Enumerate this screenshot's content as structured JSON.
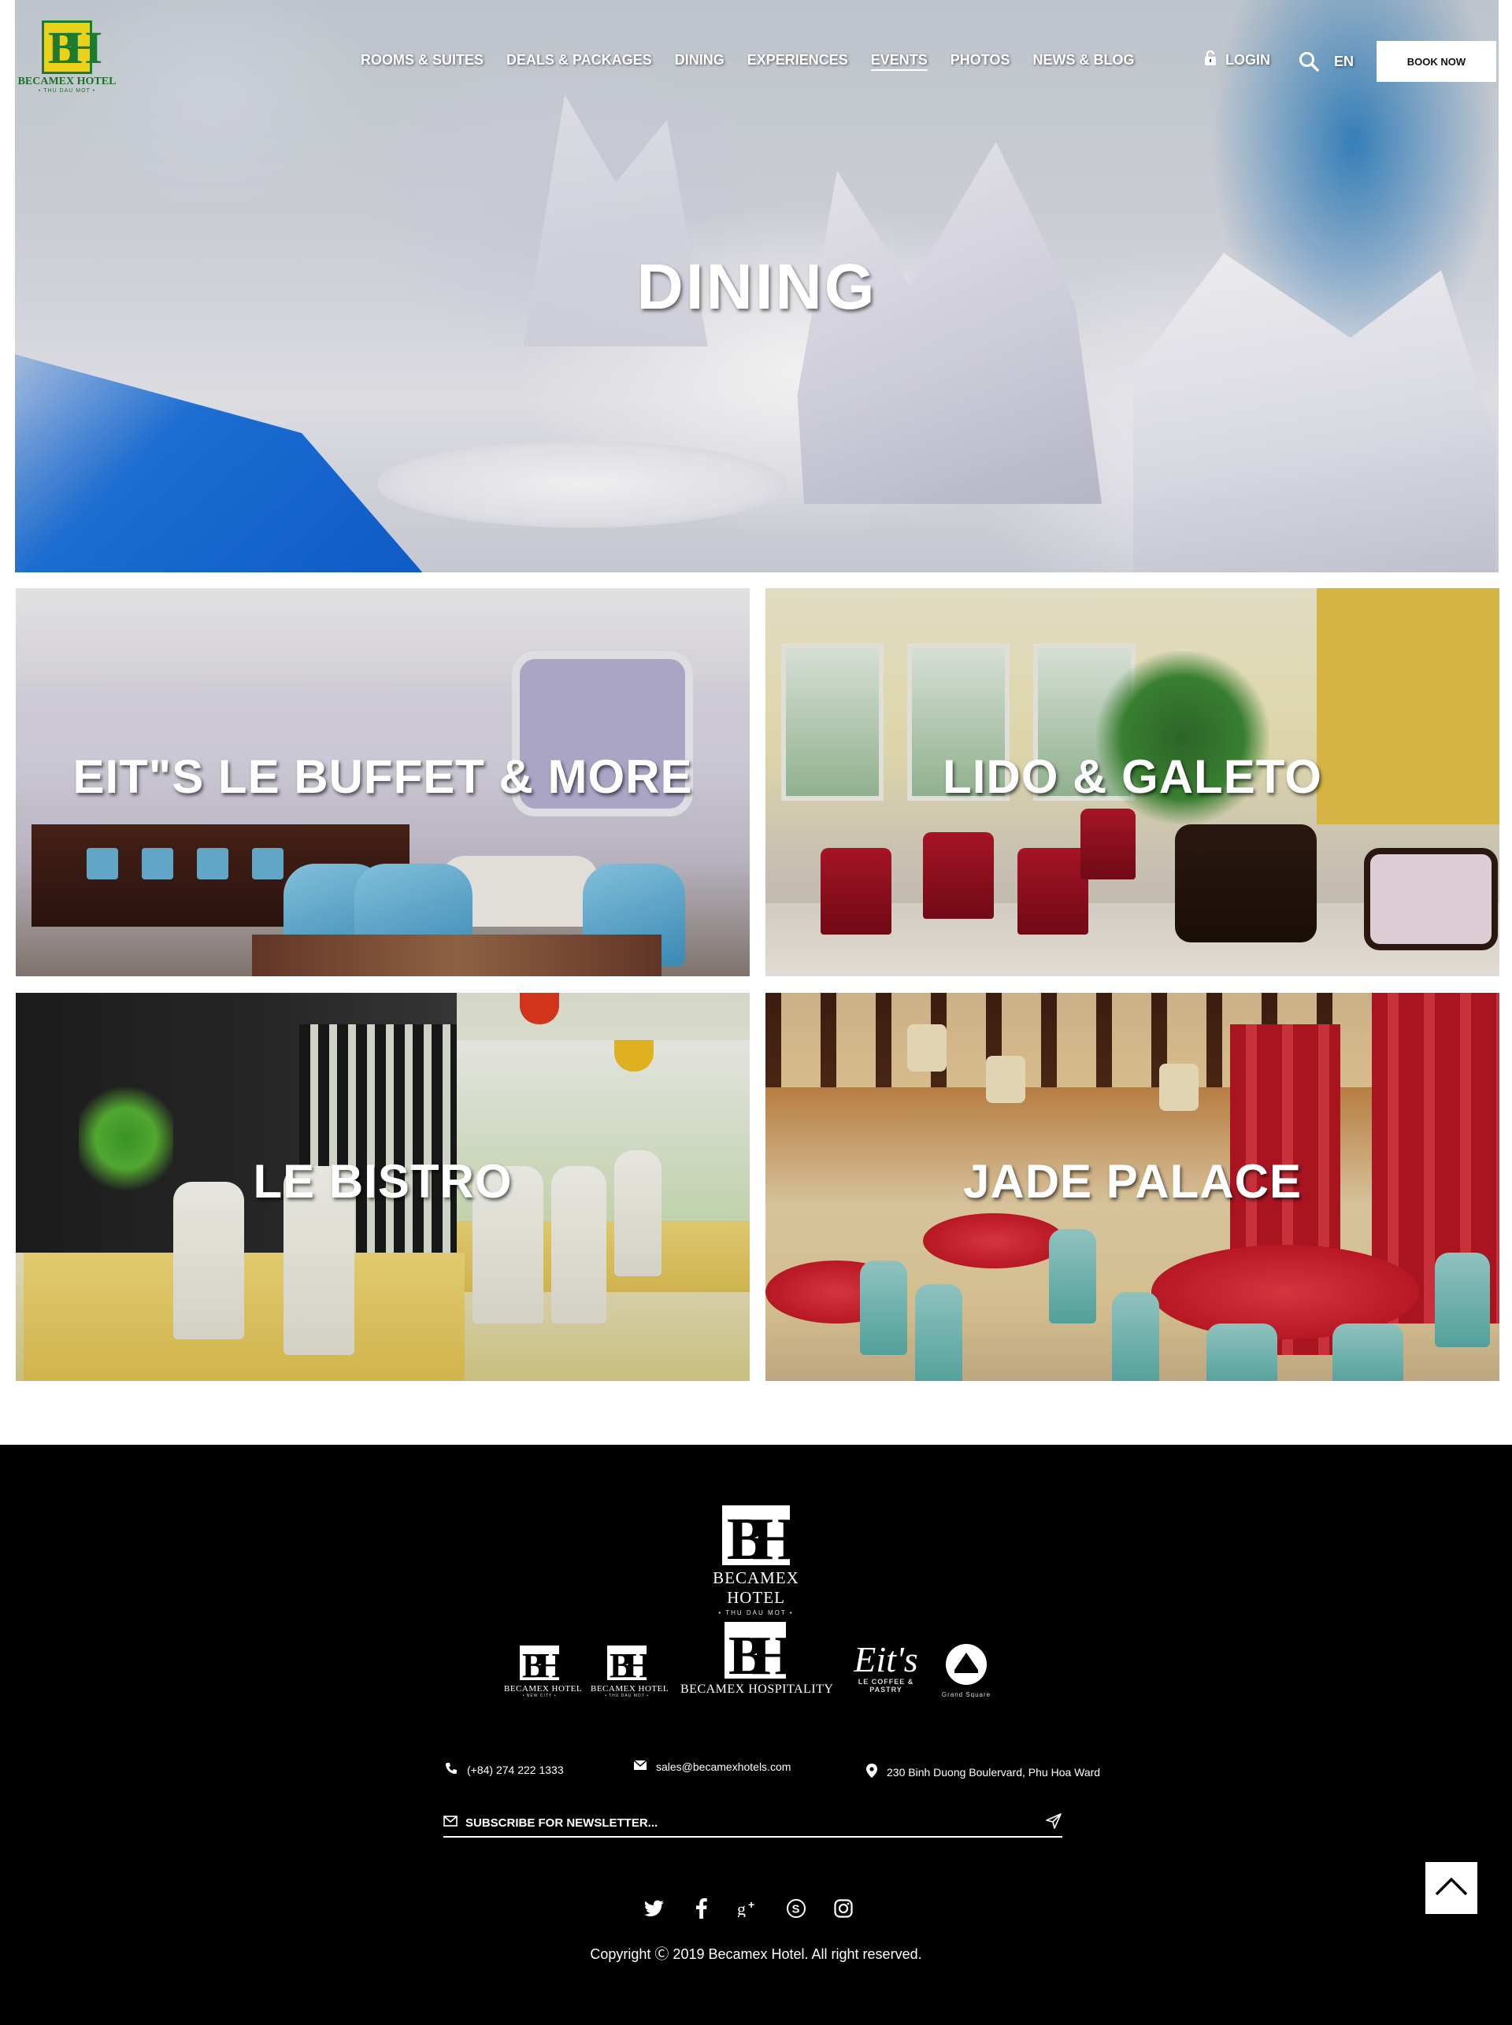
{
  "brand": {
    "logo_name": "BECAMEX HOTEL",
    "logo_sub": "• THU DAU MOT •",
    "logo_colors": {
      "yellow": "#e9d219",
      "green": "#1d7a2e"
    }
  },
  "nav": {
    "items": [
      {
        "label": "ROOMS & SUITES"
      },
      {
        "label": "DEALS & PACKAGES"
      },
      {
        "label": "DINING"
      },
      {
        "label": "EXPERIENCES"
      },
      {
        "label": "EVENTS"
      },
      {
        "label": "PHOTOS"
      },
      {
        "label": "NEWS & BLOG"
      }
    ],
    "active": "EVENTS",
    "login_label": "LOGIN",
    "lock_icon": "lock-icon",
    "search_icon": "search-icon",
    "language": "EN",
    "book_now_label": "BOOK NOW"
  },
  "hero": {
    "title": "DINING"
  },
  "restaurants": [
    {
      "name": "EIT\"S LE BUFFET & MORE"
    },
    {
      "name": "LIDO & GALETO"
    },
    {
      "name": "LE BISTRO"
    },
    {
      "name": "JADE PALACE"
    }
  ],
  "footer": {
    "logo_name": "BECAMEX HOTEL",
    "logo_sub": "• THU DAU MOT •",
    "brands": [
      {
        "name": "BECAMEX HOTEL",
        "sub": "• NEW CITY •"
      },
      {
        "name": "BECAMEX HOTEL",
        "sub": "• THU DAU MOT •"
      },
      {
        "name": "BECAMEX HOSPITALITY",
        "sub": ""
      },
      {
        "name": "Eit's",
        "sub": "LE COFFEE & PASTRY"
      },
      {
        "name": "Grand Square",
        "sub": ""
      }
    ],
    "phone": "(+84) 274 222 1333",
    "email": "sales@becamexhotels.com",
    "address": "230 Binh Duong Boulervard, Phu Hoa Ward",
    "newsletter_placeholder": "SUBSCRIBE FOR NEWSLETTER...",
    "social": [
      "twitter-icon",
      "facebook-icon",
      "google-plus-icon",
      "skype-icon",
      "instagram-icon"
    ],
    "copyright": "Copyright Ⓒ 2019 Becamex Hotel. All right reserved.",
    "back_to_top_icon": "chevron-up-icon"
  }
}
